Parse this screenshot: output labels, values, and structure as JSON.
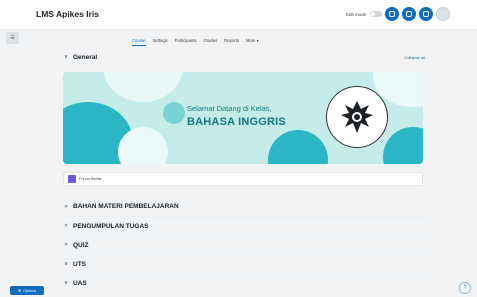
{
  "site": {
    "brand": "LMS Apikes Iris"
  },
  "topbar": {
    "edit_mode_label": "Edit mode"
  },
  "course_nav": [
    {
      "label": "Course",
      "active": true
    },
    {
      "label": "Settings",
      "active": false
    },
    {
      "label": "Participants",
      "active": false
    },
    {
      "label": "Grades",
      "active": false
    },
    {
      "label": "Reports",
      "active": false
    },
    {
      "label": "More ▾",
      "active": false
    }
  ],
  "general": {
    "title": "General",
    "collapse_label": "Collapse all",
    "banner_line1": "Selamat Datang di Kelas,",
    "banner_line2": "BAHASA INGGRIS",
    "activity_label": "Forum Berita"
  },
  "sections": [
    {
      "title": "BAHAN MATERI PEMBELAJARAN",
      "chevron": ">"
    },
    {
      "title": "PENGUMPULAN TUGAS",
      "chevron": ">"
    },
    {
      "title": "QUIZ",
      "chevron": ">"
    },
    {
      "title": "UTS",
      "chevron": "v"
    },
    {
      "title": "UAS",
      "chevron": "v"
    }
  ],
  "footer": {
    "options_label": "Options",
    "help_label": "?"
  },
  "colors": {
    "accent": "#0f6cbf",
    "banner_bg": "#c5ece9",
    "banner_text": "#0f7a82"
  }
}
